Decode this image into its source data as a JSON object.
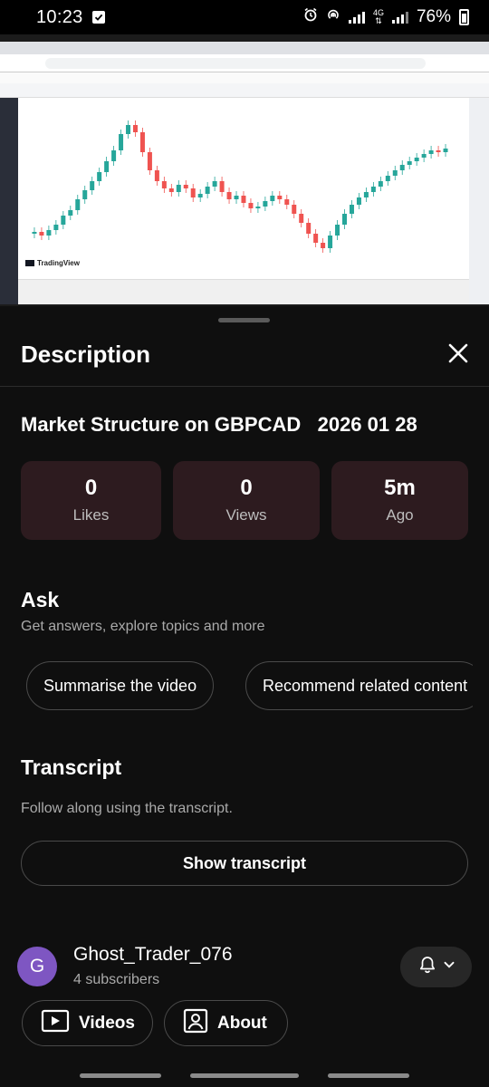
{
  "status_bar": {
    "time": "10:23",
    "network": "4G",
    "battery": "76%",
    "icons": [
      "check-icon",
      "alarm-icon",
      "hotspot-icon",
      "signal-icon",
      "battery-icon"
    ]
  },
  "video": {
    "chart_brand": "TradingView"
  },
  "sheet": {
    "title": "Description",
    "video_title": "Market Structure on GBPCAD   2026 01 28",
    "stats": [
      {
        "value": "0",
        "label": "Likes"
      },
      {
        "value": "0",
        "label": "Views"
      },
      {
        "value": "5m",
        "label": "Ago"
      }
    ],
    "ask": {
      "heading": "Ask",
      "subtitle": "Get answers, explore topics and more",
      "chips": [
        "Summarise the video",
        "Recommend related content"
      ]
    },
    "transcript": {
      "heading": "Transcript",
      "subtitle": "Follow along using the transcript.",
      "button": "Show transcript"
    },
    "channel": {
      "avatar_letter": "G",
      "name": "Ghost_Trader_076",
      "subscribers": "4 subscribers",
      "videos_label": "Videos",
      "about_label": "About"
    }
  },
  "colors": {
    "background": "#0f0f0f",
    "stat_card": "#2d1b1f",
    "avatar": "#7e56c2",
    "chart_up": "#26a69a",
    "chart_down": "#ef5350"
  }
}
